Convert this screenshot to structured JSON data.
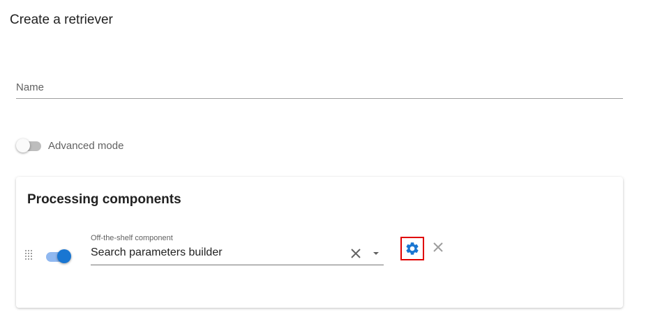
{
  "page": {
    "title": "Create a retriever"
  },
  "form": {
    "name_placeholder": "Name",
    "name_value": "",
    "advanced_mode": {
      "label": "Advanced mode",
      "enabled": false
    }
  },
  "processing": {
    "title": "Processing components",
    "components": [
      {
        "enabled": true,
        "field_label": "Off-the-shelf component",
        "value": "Search parameters builder"
      }
    ]
  },
  "icons": {
    "drag": "drag-handle-icon",
    "clear": "close-icon",
    "dropdown": "caret-down-icon",
    "settings": "gear-icon",
    "remove": "close-icon"
  },
  "colors": {
    "accent": "#1976d2",
    "highlight_box": "#e00000"
  }
}
